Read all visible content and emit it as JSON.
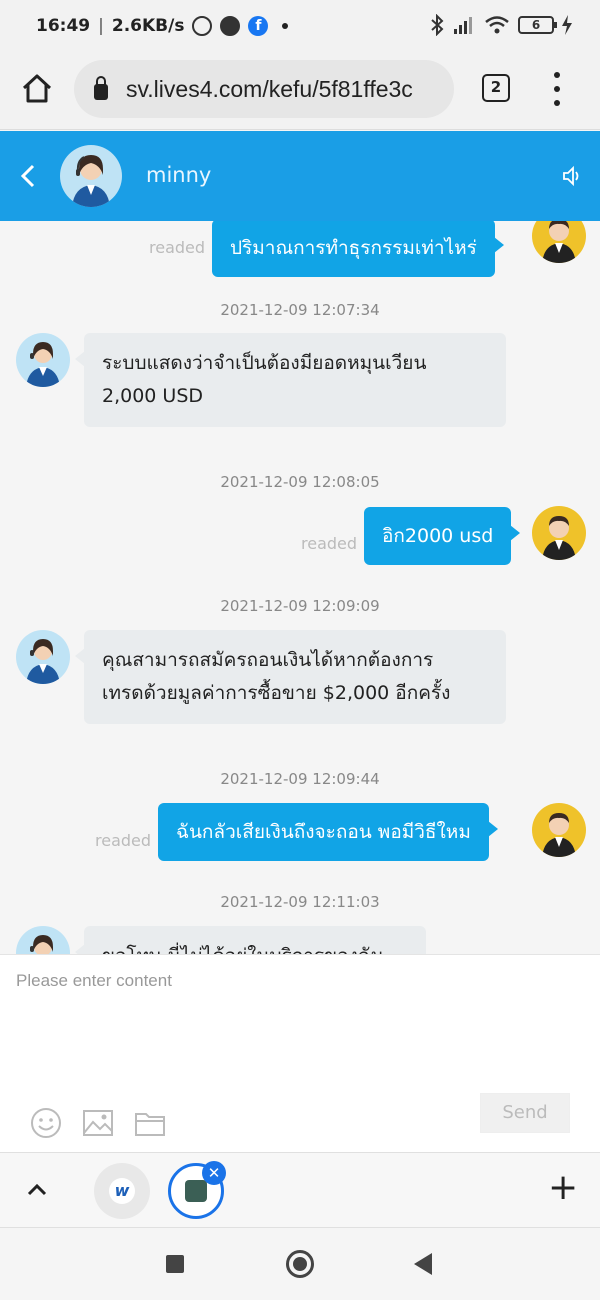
{
  "status_bar": {
    "time": "16:49",
    "network_speed": "2.6KB/s",
    "battery": "6",
    "icons": [
      "alarm-icon",
      "vpn-icon",
      "facebook-icon",
      "bluetooth-icon",
      "signal-icon",
      "wifi-icon",
      "battery-icon",
      "charging-icon"
    ]
  },
  "browser": {
    "url": "sv.lives4.com/kefu/5f81ffe3c",
    "tab_count": "2"
  },
  "chat": {
    "contact_name": "minny",
    "colors": {
      "header": "#1a9ee6",
      "outgoing_bubble": "#11a4e6",
      "incoming_bubble": "#e9ecee"
    },
    "messages": [
      {
        "type": "out",
        "text": "ปริมาณการทำธุรกรรมเท่าไหร่",
        "status": "readed"
      },
      {
        "type": "timestamp",
        "text": "2021-12-09 12:07:34"
      },
      {
        "type": "in",
        "line1": "ระบบแสดงว่าจำเป็นต้องมียอดหมุนเวียน",
        "line2": "2,000 USD"
      },
      {
        "type": "timestamp",
        "text": "2021-12-09 12:08:05"
      },
      {
        "type": "out",
        "text": "อิก2000 usd",
        "status": "readed"
      },
      {
        "type": "timestamp",
        "text": "2021-12-09 12:09:09"
      },
      {
        "type": "in",
        "line1": "คุณสามารถสมัครถอนเงินได้หากต้องการ",
        "line2": "เทรดด้วยมูลค่าการซื้อขาย $2,000 อีกครั้ง"
      },
      {
        "type": "timestamp",
        "text": "2021-12-09 12:09:44"
      },
      {
        "type": "out",
        "text": "ฉันกลัวเสียเงินถึงจะถอน พอมีวิธีใหม",
        "status": "readed"
      },
      {
        "type": "timestamp",
        "text": "2021-12-09 12:11:03"
      },
      {
        "type": "in",
        "line1": "ขอโทษ นี่ไม่ได้อยู่ในบริการของฉัน"
      }
    ]
  },
  "composer": {
    "placeholder": "Please enter content",
    "send_label": "Send",
    "tools": [
      "emoji-icon",
      "image-icon",
      "folder-icon"
    ]
  },
  "tabs_bar": {
    "close_glyph": "✕",
    "new_tab_glyph": "+",
    "w_logo": "w"
  }
}
